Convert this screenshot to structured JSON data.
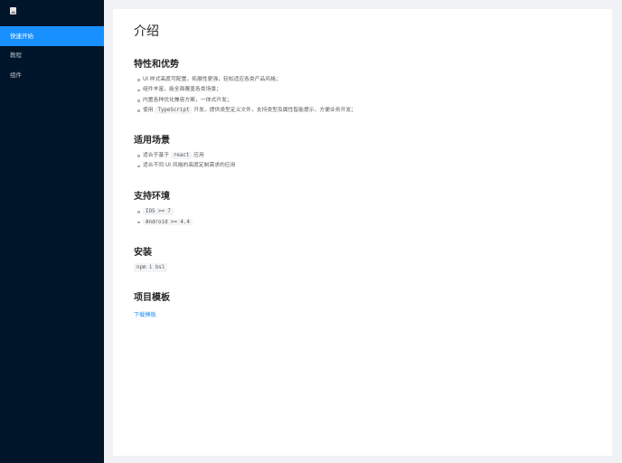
{
  "sidebar": {
    "items": [
      {
        "label": "快速开始",
        "active": true
      },
      {
        "label": "教程"
      },
      {
        "label": "组件"
      }
    ]
  },
  "main": {
    "title": "介绍",
    "features": {
      "heading": "特性和优势",
      "items": [
        "UI 样式高度可配置，拓展性更强，轻松适应各类产品风格；",
        "组件丰富，能全面覆盖各类场景；",
        "内置各种优化兼容方案，一体式开发；",
        {
          "before": "使用",
          "code": "TypeScript",
          "after": "开发，提供类型定义文件，支持类型及属性智能提示，方便业务开发；"
        }
      ]
    },
    "usage": {
      "heading": "适用场景",
      "item1": {
        "before": "适合于基于",
        "code": "react",
        "after": "应用"
      },
      "item2": "适合不同 UI 风格的高度定制需求的应用"
    },
    "env": {
      "heading": "支持环境",
      "items": [
        "IOS >= 7",
        "Android >= 4.4"
      ]
    },
    "install": {
      "heading": "安装",
      "command": "npm i bsl"
    },
    "template": {
      "heading": "项目模板",
      "link": "下载模板"
    }
  },
  "colors": {
    "sidebar_bg": "#001529",
    "accent": "#1890ff"
  }
}
